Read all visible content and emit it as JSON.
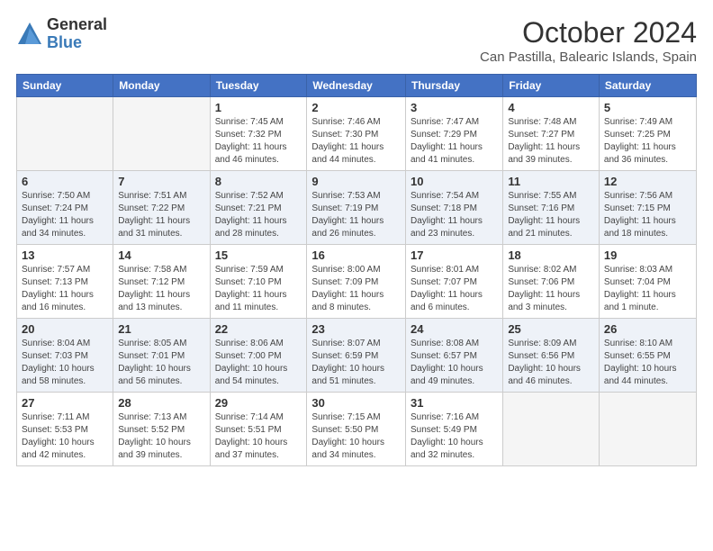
{
  "logo": {
    "general": "General",
    "blue": "Blue"
  },
  "title": "October 2024",
  "subtitle": "Can Pastilla, Balearic Islands, Spain",
  "days_of_week": [
    "Sunday",
    "Monday",
    "Tuesday",
    "Wednesday",
    "Thursday",
    "Friday",
    "Saturday"
  ],
  "weeks": [
    [
      {
        "day": "",
        "info": ""
      },
      {
        "day": "",
        "info": ""
      },
      {
        "day": "1",
        "info": "Sunrise: 7:45 AM\nSunset: 7:32 PM\nDaylight: 11 hours and 46 minutes."
      },
      {
        "day": "2",
        "info": "Sunrise: 7:46 AM\nSunset: 7:30 PM\nDaylight: 11 hours and 44 minutes."
      },
      {
        "day": "3",
        "info": "Sunrise: 7:47 AM\nSunset: 7:29 PM\nDaylight: 11 hours and 41 minutes."
      },
      {
        "day": "4",
        "info": "Sunrise: 7:48 AM\nSunset: 7:27 PM\nDaylight: 11 hours and 39 minutes."
      },
      {
        "day": "5",
        "info": "Sunrise: 7:49 AM\nSunset: 7:25 PM\nDaylight: 11 hours and 36 minutes."
      }
    ],
    [
      {
        "day": "6",
        "info": "Sunrise: 7:50 AM\nSunset: 7:24 PM\nDaylight: 11 hours and 34 minutes."
      },
      {
        "day": "7",
        "info": "Sunrise: 7:51 AM\nSunset: 7:22 PM\nDaylight: 11 hours and 31 minutes."
      },
      {
        "day": "8",
        "info": "Sunrise: 7:52 AM\nSunset: 7:21 PM\nDaylight: 11 hours and 28 minutes."
      },
      {
        "day": "9",
        "info": "Sunrise: 7:53 AM\nSunset: 7:19 PM\nDaylight: 11 hours and 26 minutes."
      },
      {
        "day": "10",
        "info": "Sunrise: 7:54 AM\nSunset: 7:18 PM\nDaylight: 11 hours and 23 minutes."
      },
      {
        "day": "11",
        "info": "Sunrise: 7:55 AM\nSunset: 7:16 PM\nDaylight: 11 hours and 21 minutes."
      },
      {
        "day": "12",
        "info": "Sunrise: 7:56 AM\nSunset: 7:15 PM\nDaylight: 11 hours and 18 minutes."
      }
    ],
    [
      {
        "day": "13",
        "info": "Sunrise: 7:57 AM\nSunset: 7:13 PM\nDaylight: 11 hours and 16 minutes."
      },
      {
        "day": "14",
        "info": "Sunrise: 7:58 AM\nSunset: 7:12 PM\nDaylight: 11 hours and 13 minutes."
      },
      {
        "day": "15",
        "info": "Sunrise: 7:59 AM\nSunset: 7:10 PM\nDaylight: 11 hours and 11 minutes."
      },
      {
        "day": "16",
        "info": "Sunrise: 8:00 AM\nSunset: 7:09 PM\nDaylight: 11 hours and 8 minutes."
      },
      {
        "day": "17",
        "info": "Sunrise: 8:01 AM\nSunset: 7:07 PM\nDaylight: 11 hours and 6 minutes."
      },
      {
        "day": "18",
        "info": "Sunrise: 8:02 AM\nSunset: 7:06 PM\nDaylight: 11 hours and 3 minutes."
      },
      {
        "day": "19",
        "info": "Sunrise: 8:03 AM\nSunset: 7:04 PM\nDaylight: 11 hours and 1 minute."
      }
    ],
    [
      {
        "day": "20",
        "info": "Sunrise: 8:04 AM\nSunset: 7:03 PM\nDaylight: 10 hours and 58 minutes."
      },
      {
        "day": "21",
        "info": "Sunrise: 8:05 AM\nSunset: 7:01 PM\nDaylight: 10 hours and 56 minutes."
      },
      {
        "day": "22",
        "info": "Sunrise: 8:06 AM\nSunset: 7:00 PM\nDaylight: 10 hours and 54 minutes."
      },
      {
        "day": "23",
        "info": "Sunrise: 8:07 AM\nSunset: 6:59 PM\nDaylight: 10 hours and 51 minutes."
      },
      {
        "day": "24",
        "info": "Sunrise: 8:08 AM\nSunset: 6:57 PM\nDaylight: 10 hours and 49 minutes."
      },
      {
        "day": "25",
        "info": "Sunrise: 8:09 AM\nSunset: 6:56 PM\nDaylight: 10 hours and 46 minutes."
      },
      {
        "day": "26",
        "info": "Sunrise: 8:10 AM\nSunset: 6:55 PM\nDaylight: 10 hours and 44 minutes."
      }
    ],
    [
      {
        "day": "27",
        "info": "Sunrise: 7:11 AM\nSunset: 5:53 PM\nDaylight: 10 hours and 42 minutes."
      },
      {
        "day": "28",
        "info": "Sunrise: 7:13 AM\nSunset: 5:52 PM\nDaylight: 10 hours and 39 minutes."
      },
      {
        "day": "29",
        "info": "Sunrise: 7:14 AM\nSunset: 5:51 PM\nDaylight: 10 hours and 37 minutes."
      },
      {
        "day": "30",
        "info": "Sunrise: 7:15 AM\nSunset: 5:50 PM\nDaylight: 10 hours and 34 minutes."
      },
      {
        "day": "31",
        "info": "Sunrise: 7:16 AM\nSunset: 5:49 PM\nDaylight: 10 hours and 32 minutes."
      },
      {
        "day": "",
        "info": ""
      },
      {
        "day": "",
        "info": ""
      }
    ]
  ]
}
